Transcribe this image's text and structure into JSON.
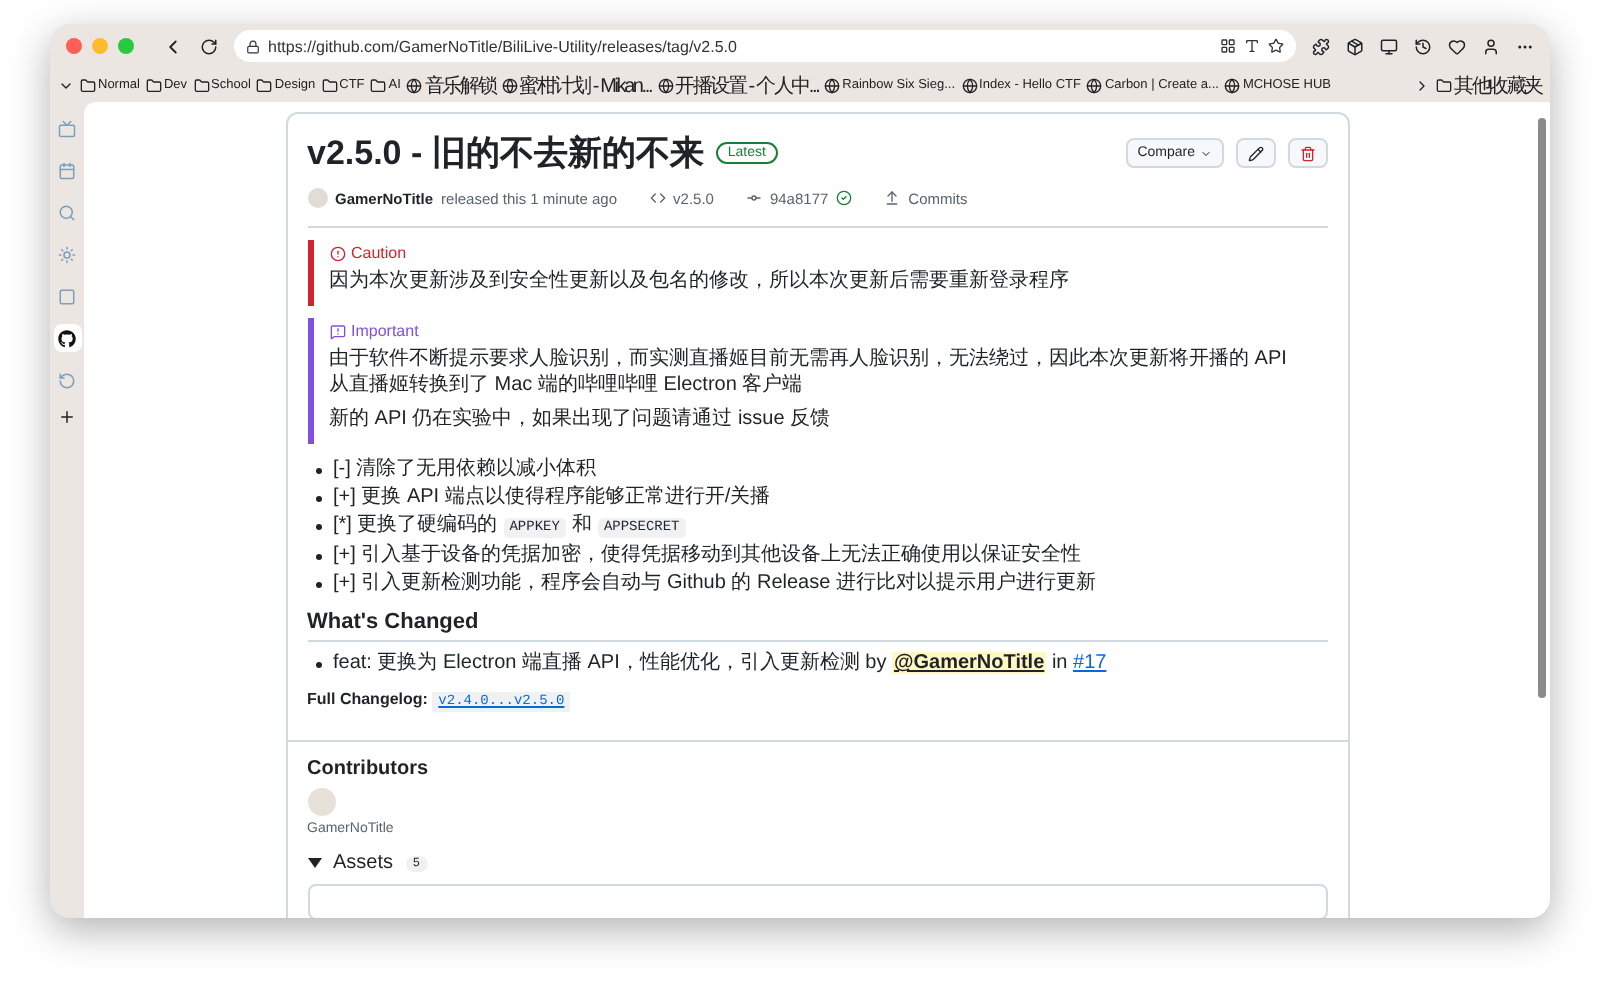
{
  "browser": {
    "url": "https://github.com/GamerNoTitle/BiliLive-Utility/releases/tag/v2.5.0"
  },
  "bookmarks": [
    {
      "label": "Normal",
      "kind": "folder"
    },
    {
      "label": "Dev",
      "kind": "folder"
    },
    {
      "label": "School",
      "kind": "folder"
    },
    {
      "label": "Design",
      "kind": "folder"
    },
    {
      "label": "CTF",
      "kind": "folder"
    },
    {
      "label": "AI",
      "kind": "folder"
    },
    {
      "label": "音乐解锁",
      "kind": "site"
    },
    {
      "label": "蜜柑计划 - Mikan...",
      "kind": "site"
    },
    {
      "label": "开播设置 - 个人中...",
      "kind": "site"
    },
    {
      "label": "Rainbow Six Sieg...",
      "kind": "site"
    },
    {
      "label": "Index - Hello CTF",
      "kind": "site"
    },
    {
      "label": "Carbon | Create a...",
      "kind": "site"
    },
    {
      "label": "MCHOSE HUB",
      "kind": "site"
    }
  ],
  "other_bookmarks": "其他收藏夹",
  "sidebar": {
    "items": [
      {
        "kind": "tv",
        "selected": false
      },
      {
        "kind": "calendar",
        "selected": false
      },
      {
        "kind": "search",
        "selected": false
      },
      {
        "kind": "sun",
        "selected": false
      },
      {
        "kind": "square",
        "selected": false
      },
      {
        "kind": "github",
        "selected": true
      },
      {
        "kind": "refresh",
        "selected": false
      }
    ]
  },
  "release": {
    "title": "v2.5.0 - 旧的不去新的不来",
    "badge": "Latest",
    "compare": "Compare",
    "author": "GamerNoTitle",
    "released": "released this 1 minute ago",
    "tag": "v2.5.0",
    "commit": "94a8177",
    "verified": true,
    "commits": "Commits"
  },
  "alerts": [
    {
      "kind": "caution",
      "title": "Caution",
      "paragraphs": [
        "因为本次更新涉及到安全性更新以及包名的修改，所以本次更新后需要重新登录程序"
      ]
    },
    {
      "kind": "important",
      "title": "Important",
      "paragraphs": [
        "由于软件不断提示要求人脸识别，而实测直播姬目前无需再人脸识别，无法绕过，因此本次更新将开播的 API 从直播姬转换到了 Mac 端的哔哩哔哩 Electron 客户端",
        "新的 API 仍在实验中，如果出现了问题请通过 issue 反馈"
      ]
    }
  ],
  "changes": [
    [
      {
        "text": "[-] 清除了无用依赖以减小体积",
        "code": false
      }
    ],
    [
      {
        "text": "[+] 更换 API 端点以使得程序能够正常进行开/关播",
        "code": false
      }
    ],
    [
      {
        "text": "[*] 更换了硬编码的",
        "code": false
      },
      {
        "text": "APPKEY",
        "code": true
      },
      {
        "text": "和",
        "code": false
      },
      {
        "text": "APPSECRET",
        "code": true
      }
    ],
    [
      {
        "text": "[+] 引入基于设备的凭据加密，使得凭据移动到其他设备上无法正确使用以保证安全性",
        "code": false
      }
    ],
    [
      {
        "text": "[+] 引入更新检测功能，程序会自动与 Github 的 Release 进行比对以提示用户进行更新",
        "code": false
      }
    ]
  ],
  "whats_changed": {
    "heading": "What's Changed",
    "item": "feat: 更换为 Electron 端直播 API，性能优化，引入更新检测 by",
    "mention": "@GamerNoTitle",
    "in": "in",
    "pr": "#17",
    "full_changelog_label": "Full Changelog:",
    "full_changelog_link": "v2.4.0...v2.5.0"
  },
  "contributors": {
    "heading": "Contributors",
    "names": [
      "GamerNoTitle"
    ]
  },
  "assets": {
    "heading": "Assets",
    "count": "5",
    "expanded": true
  }
}
